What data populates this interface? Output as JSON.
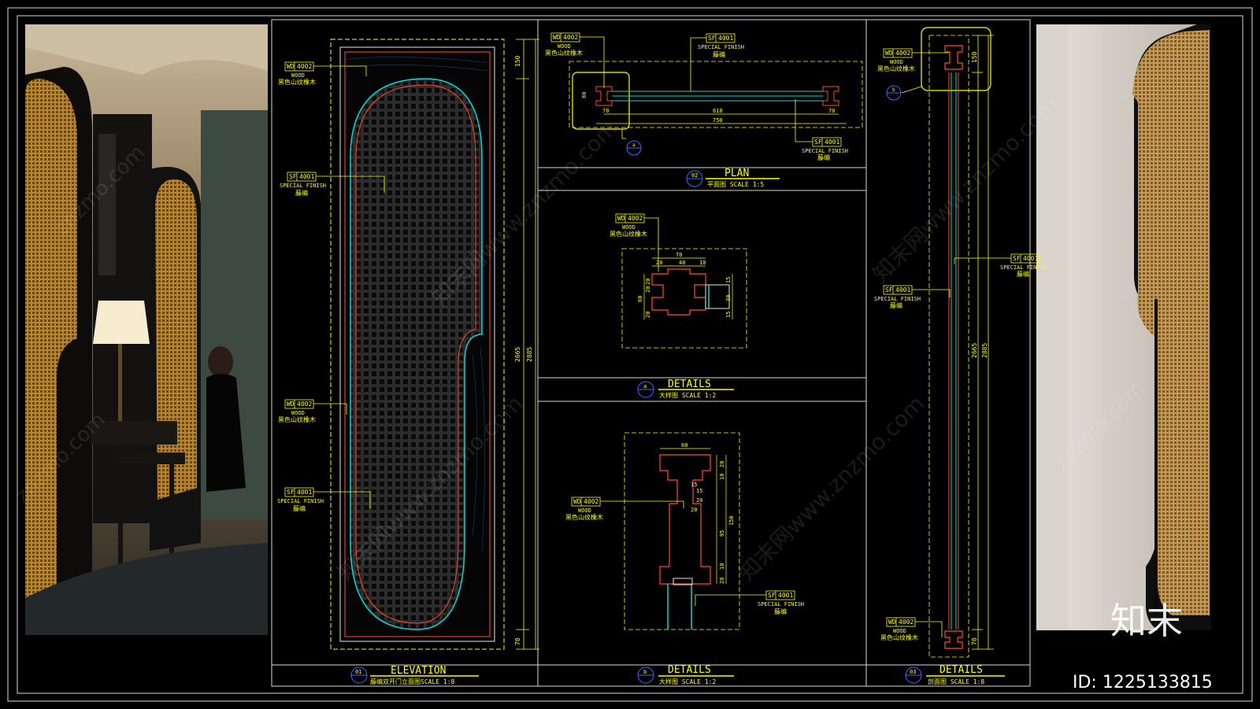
{
  "drawing": {
    "tags": {
      "wd": {
        "code": "WD",
        "num": "4002",
        "en": "WOOD",
        "cn": "黑色山纹橡木"
      },
      "sf": {
        "code": "SF",
        "num": "4001",
        "en": "SPECIAL FINISH",
        "cn": "藤编"
      }
    },
    "elevation": {
      "no": "01",
      "title": "ELEVATION",
      "subtitle": "藤编双开门立面图SCALE 1:8",
      "dims": {
        "top": "150",
        "h1": "2665",
        "h2": "2885",
        "bottom": "70"
      }
    },
    "plan": {
      "no": "02",
      "title": "PLAN",
      "subtitle": "平面图   SCALE 1:5",
      "section_mark": "a",
      "dims": {
        "inner": "610",
        "outer": "750",
        "left": "70",
        "right": "70",
        "side": "80"
      }
    },
    "detail_a": {
      "no": "a",
      "title": "DETAILS",
      "subtitle": "大样图   SCALE 1:2",
      "dims": {
        "w": "70",
        "a": "20",
        "b": "40",
        "c": "10",
        "v1": "20",
        "v2": "20",
        "v3": "60",
        "v4": "20",
        "r1": "15",
        "r2": "30",
        "r3": "15"
      }
    },
    "detail_b": {
      "no": "b",
      "title": "DETAILS",
      "subtitle": "大样图   SCALE 1:2",
      "dims": {
        "w": "60",
        "t1": "20",
        "t2": "10",
        "t3": "15",
        "t4": "20",
        "m1": "95",
        "m2": "150",
        "b1": "10",
        "b2": "20",
        "s1": "15",
        "s2": "20"
      }
    },
    "section": {
      "no": "03",
      "title": "DETAILS",
      "subtitle": "剖面图         SCALE 1:8",
      "section_mark": "b",
      "dims": {
        "top": "150",
        "h1": "2665",
        "h2": "2885",
        "bottom": "70"
      }
    }
  },
  "watermark": {
    "text": "知末网www.znzmo.com",
    "short": "znzmo.com"
  },
  "brand": {
    "logo": "知末",
    "id_label": "ID: 1225133815"
  },
  "colors": {
    "yellow": "#ffff00",
    "red": "#ff4a2a",
    "cyan": "#00d8d8",
    "blue": "#3a6cff",
    "white": "#e6e6e6"
  }
}
